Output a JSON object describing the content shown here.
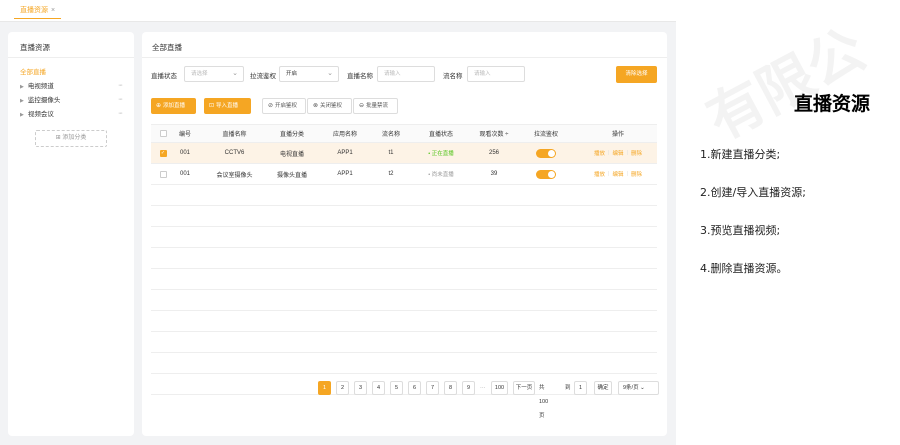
{
  "tab": {
    "label": "直播资源",
    "close": "×"
  },
  "left": {
    "title": "直播资源",
    "items": [
      {
        "label": "全部直播",
        "active": true
      },
      {
        "label": "电视频道",
        "more": "···"
      },
      {
        "label": "监控摄像头",
        "more": "···"
      },
      {
        "label": "视频会议",
        "more": "···"
      }
    ],
    "add_label": "添加分类"
  },
  "main": {
    "title": "全部直播",
    "filters": {
      "status_label": "直播状态",
      "status_placeholder": "请选择",
      "auth_label": "拉流鉴权",
      "auth_value": "开启",
      "name_label": "直播名称",
      "name_placeholder": "请输入",
      "stream_label": "流名称",
      "stream_placeholder": "请输入",
      "clear_label": "清除选择"
    },
    "toolbar": {
      "add": "添加直播",
      "import": "导入直播",
      "enable_auth": "开启鉴权",
      "disable_auth": "关闭鉴权",
      "batch_disable": "批量禁流"
    },
    "columns": [
      "编号",
      "直播名称",
      "直播分类",
      "应用名称",
      "流名称",
      "直播状态",
      "观看次数 ÷",
      "拉流鉴权",
      "操作"
    ],
    "rows": [
      {
        "id": "001",
        "name": "CCTV6",
        "category": "电视直播",
        "app": "APP1",
        "stream": "t1",
        "status": "• 正在直播",
        "views": "256",
        "checked": true
      },
      {
        "id": "001",
        "name": "会议室摄像头",
        "category": "摄像头直播",
        "app": "APP1",
        "stream": "t2",
        "status": "• 尚未直播",
        "views": "39",
        "checked": false
      }
    ],
    "ops": {
      "preview": "播放",
      "edit": "编辑",
      "delete": "删除"
    },
    "pager": {
      "pages": [
        "1",
        "2",
        "3",
        "4",
        "5",
        "6",
        "7",
        "8",
        "9"
      ],
      "ellipsis": "···",
      "last": "100",
      "next": "下一页",
      "total": "共100页",
      "goto": "到",
      "goto_value": "1",
      "confirm": "确定",
      "page_size": "9条/页"
    }
  },
  "side": {
    "title": "直播资源",
    "items": [
      "1.新建直播分类;",
      "2.创建/导入直播资源;",
      "3.预览直播视频;",
      "4.删除直播资源。"
    ],
    "watermark": "有限公"
  },
  "colors": {
    "accent": "#f5a623",
    "live": "#52c41a"
  }
}
